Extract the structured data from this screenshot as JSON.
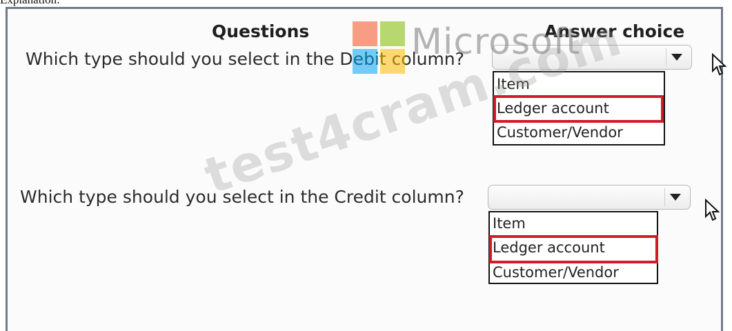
{
  "caption": "Explanation:",
  "headers": {
    "questions": "Questions",
    "answer_choice": "Answer choice"
  },
  "brand": {
    "text": "Microsoft",
    "colors": [
      "#f25022",
      "#7fba00",
      "#00a4ef",
      "#ffb900"
    ]
  },
  "watermark": "test4cram.com",
  "questions": [
    {
      "text": "Which type should you select in the Debit column?",
      "options": [
        "Item",
        "Ledger account",
        "Customer/Vendor"
      ],
      "selected": "Ledger account"
    },
    {
      "text": "Which type should you select in the Credit column?",
      "options": [
        "Item",
        "Ledger account",
        "Customer/Vendor"
      ],
      "selected": "Ledger account"
    }
  ],
  "highlight_color": "#d11a2a",
  "icons": [
    "dropdown-arrow-icon",
    "mouse-pointer-icon"
  ]
}
